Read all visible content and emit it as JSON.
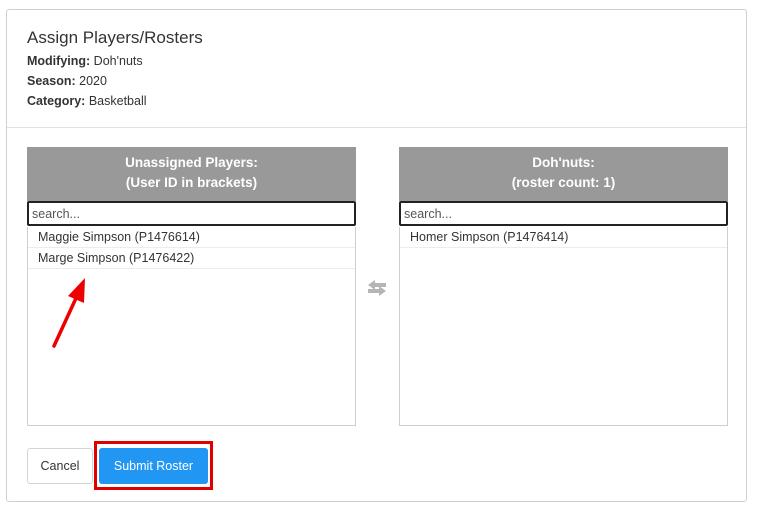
{
  "header": {
    "title": "Assign Players/Rosters",
    "modifying_label": "Modifying:",
    "modifying_value": "Doh'nuts",
    "season_label": "Season:",
    "season_value": "2020",
    "category_label": "Category:",
    "category_value": "Basketball"
  },
  "left_panel": {
    "title_line1": "Unassigned Players:",
    "title_line2": "(User ID in brackets)",
    "search_placeholder": "search...",
    "items": [
      {
        "label": "Maggie Simpson (P1476614)"
      },
      {
        "label": "Marge Simpson (P1476422)"
      }
    ]
  },
  "right_panel": {
    "title_line1": "Doh'nuts:",
    "title_line2": "(roster count: 1)",
    "search_placeholder": "search...",
    "items": [
      {
        "label": "Homer Simpson (P1476414)"
      }
    ]
  },
  "icons": {
    "swap": "swap-arrows-icon",
    "annotation": "red-arrow-annotation"
  },
  "colors": {
    "panel_header": "#999999",
    "primary_button": "#2196f3",
    "highlight": "#e00000"
  },
  "footer": {
    "cancel_label": "Cancel",
    "submit_label": "Submit Roster"
  }
}
